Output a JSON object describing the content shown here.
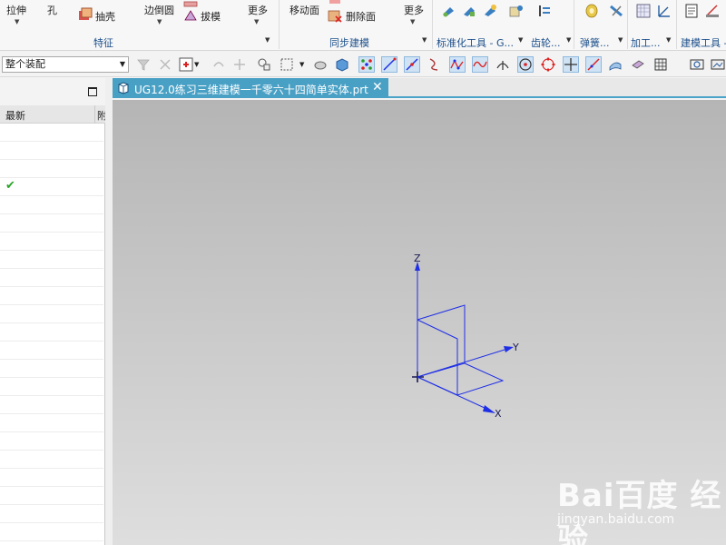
{
  "ribbon": {
    "extrude": "拉伸",
    "hole": "孔",
    "shell": "抽壳",
    "edge_blend": "边倒圆",
    "draft": "拔模",
    "more1": "更多",
    "group_feature": "特征",
    "move_face": "移动面",
    "delete_face": "删除面",
    "more2": "更多",
    "group_sync": "同步建模",
    "group_standard": "标准化工具 - G...",
    "group_gear": "齿轮...",
    "group_spring": "弹簧...",
    "group_machining": "加工...",
    "group_modeling_tools": "建模工具 -"
  },
  "toolbar": {
    "assembly_filter": "整个装配"
  },
  "navigator": {
    "col_latest": "最新",
    "col_second": "附",
    "row_count": 23,
    "checked_row": 3
  },
  "document": {
    "tab_title": "UG12.0练习三维建模一千零六十四简单实体.prt",
    "close": "✕"
  },
  "viewport": {
    "axis_x": "X",
    "axis_y": "Y",
    "axis_z": "Z",
    "wire_color": "#1f2fe6"
  },
  "watermark": {
    "logo": "Bai百度 经验",
    "site": "jingyan.baidu.com"
  },
  "colors": {
    "tab_accent": "#49a0c5",
    "check_green": "#2aa52a"
  }
}
